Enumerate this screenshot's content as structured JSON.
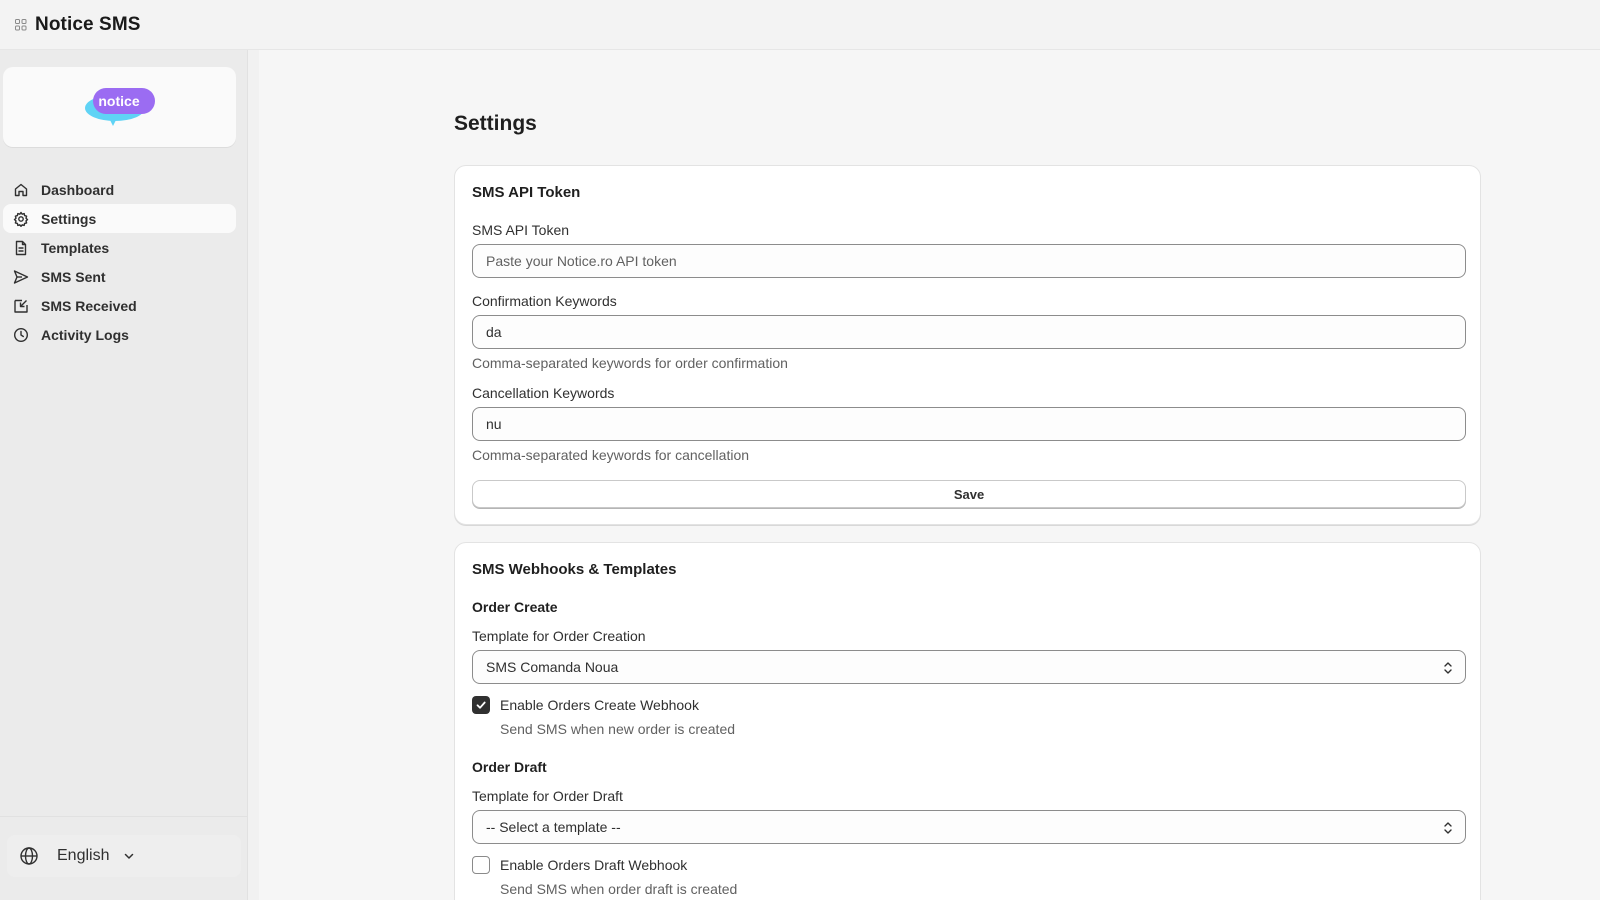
{
  "app": {
    "title": "Notice SMS",
    "logo_text": "notice"
  },
  "sidebar": {
    "items": [
      {
        "label": "Dashboard",
        "icon": "home-icon"
      },
      {
        "label": "Settings",
        "icon": "gear-icon",
        "active": true
      },
      {
        "label": "Templates",
        "icon": "document-icon"
      },
      {
        "label": "SMS Sent",
        "icon": "send-icon"
      },
      {
        "label": "SMS Received",
        "icon": "inbox-icon"
      },
      {
        "label": "Activity Logs",
        "icon": "clock-icon"
      }
    ],
    "language": {
      "value": "English",
      "icon": "globe-icon"
    }
  },
  "page": {
    "title": "Settings"
  },
  "api_card": {
    "title": "SMS API Token",
    "token_label": "SMS API Token",
    "token_value": "",
    "token_placeholder": "Paste your Notice.ro API token",
    "confirm_label": "Confirmation Keywords",
    "confirm_value": "da",
    "confirm_help": "Comma-separated keywords for order confirmation",
    "cancel_label": "Cancellation Keywords",
    "cancel_value": "nu",
    "cancel_help": "Comma-separated keywords for cancellation",
    "save_label": "Save"
  },
  "webhooks_card": {
    "title": "SMS Webhooks & Templates",
    "order_create": {
      "heading": "Order Create",
      "template_label": "Template for Order Creation",
      "template_value": "SMS Comanda Noua",
      "webhook_label": "Enable Orders Create Webhook",
      "webhook_checked": true,
      "webhook_help": "Send SMS when new order is created"
    },
    "order_draft": {
      "heading": "Order Draft",
      "template_label": "Template for Order Draft",
      "template_value": "-- Select a template --",
      "webhook_label": "Enable Orders Draft Webhook",
      "webhook_checked": false,
      "webhook_help": "Send SMS when order draft is created"
    }
  },
  "colors": {
    "accent": "#303030",
    "logo_purple": "#9b6cf2",
    "logo_cyan": "#5fd3f5"
  }
}
